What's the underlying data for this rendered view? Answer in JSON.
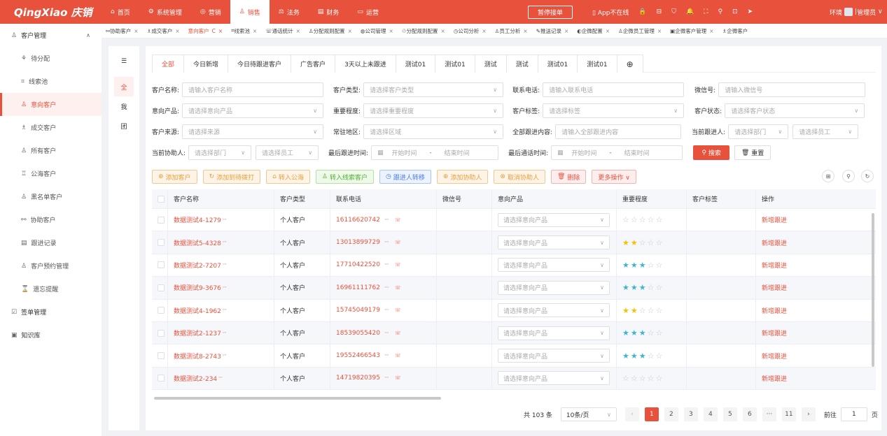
{
  "brand": "QingXiao 庆销",
  "nav": [
    {
      "icon": "⌂",
      "label": "首页"
    },
    {
      "icon": "⚙",
      "label": "系统管理"
    },
    {
      "icon": "◎",
      "label": "营销"
    },
    {
      "icon": "♙",
      "label": "销售"
    },
    {
      "icon": "⚖",
      "label": "法务"
    },
    {
      "icon": "▤",
      "label": "财务"
    },
    {
      "icon": "▭",
      "label": "运营"
    }
  ],
  "pause_button": "暂停接单",
  "app_status": "App不在线",
  "top_icons": [
    "lock-icon",
    "message-icon",
    "shirt-icon",
    "bell-icon",
    "fullscreen-icon",
    "search-icon",
    "inbox-icon",
    "send-icon"
  ],
  "top_glyphs": [
    "🔒",
    "⊟",
    "⛉",
    "🔔",
    "⛶",
    "⚲",
    "⊡",
    "➤"
  ],
  "env_label": "环境",
  "user": "管理员",
  "sidebar": {
    "group1": {
      "icon": "♙",
      "label": "客户管理"
    },
    "items": [
      {
        "icon": "⚘",
        "label": "待分配"
      },
      {
        "icon": "⌗",
        "label": "线索池"
      },
      {
        "icon": "♙",
        "label": "意向客户",
        "active": true
      },
      {
        "icon": "♗",
        "label": "成交客户"
      },
      {
        "icon": "♙",
        "label": "所有客户"
      },
      {
        "icon": "♖",
        "label": "公海客户"
      },
      {
        "icon": "♙",
        "label": "黑名单客户"
      },
      {
        "icon": "⚯",
        "label": "协助客户"
      },
      {
        "icon": "▤",
        "label": "跟进记录"
      },
      {
        "icon": "♙",
        "label": "客户预约管理"
      },
      {
        "icon": "⌛",
        "label": "遗忘提醒"
      }
    ],
    "group2": {
      "icon": "☑",
      "label": "签单管理"
    },
    "group3": {
      "icon": "▣",
      "label": "知识库"
    }
  },
  "tabs": [
    {
      "label": "协助客户"
    },
    {
      "label": "成交客户"
    },
    {
      "label": "意向客户",
      "active": true
    },
    {
      "label": "线索池"
    },
    {
      "label": "通话统计"
    },
    {
      "label": "分配规则配置"
    },
    {
      "label": "公司管理"
    },
    {
      "label": "分配规则配置"
    },
    {
      "label": "公司分析"
    },
    {
      "label": "员工分析"
    },
    {
      "label": "推送记录"
    },
    {
      "label": "企微配置"
    },
    {
      "label": "企微员工管理"
    },
    {
      "label": "企微客户管理"
    },
    {
      "label": "企微客户"
    }
  ],
  "tab_icons": [
    "⚯",
    "♗",
    "",
    "⌗",
    "☏",
    "♙",
    "◍",
    "♲",
    "◷",
    "♙",
    "✎",
    "◐",
    "♙",
    "▣",
    "♗"
  ],
  "mini": [
    "全",
    "我",
    "团"
  ],
  "filter_tabs": [
    "全部",
    "今日新增",
    "今日待跟进客户",
    "广告客户",
    "3天以上未跟进",
    "测试01",
    "测试01",
    "测试",
    "测试",
    "测试01",
    "测试01"
  ],
  "filters": {
    "name_label": "客户名称:",
    "name_ph": "请输入客户名称",
    "type_label": "客户类型:",
    "type_ph": "请选择客户类型",
    "phone_label": "联系电话:",
    "phone_ph": "请输入联系电话",
    "wx_label": "微信号:",
    "wx_ph": "请输入微信号",
    "product_label": "意向产品:",
    "product_ph": "请选择意向产品",
    "importance_label": "重要程度:",
    "importance_ph": "请选择重要程度",
    "tag_label": "客户标签:",
    "tag_ph": "请选择标签",
    "status_label": "客户状态:",
    "status_ph": "请选择客户状态",
    "source_label": "客户来源:",
    "source_ph": "请选择来源",
    "region_label": "常驻地区:",
    "region_ph": "请选择区域",
    "followall_label": "全部跟进内容:",
    "followall_ph": "请输入全部跟进内容",
    "follower_label": "当前跟进人:",
    "dept_ph": "请选择部门",
    "emp_ph": "请选择员工",
    "assist_label": "当前协助人:",
    "lastfollow_label": "最后跟进时间:",
    "start_ph": "开始时间",
    "end_ph": "结束时间",
    "dash": "-",
    "lastcall_label": "最后通话时间:",
    "search_btn": "搜索",
    "reset_btn": "重置"
  },
  "actions": [
    {
      "icon": "⊕",
      "label": "添加客户",
      "style": "orange"
    },
    {
      "icon": "↻",
      "label": "添加到待拨打",
      "style": "orange"
    },
    {
      "icon": "⌂",
      "label": "转入公海",
      "style": "orange"
    },
    {
      "icon": "♙",
      "label": "转入线索客户",
      "style": "green"
    },
    {
      "icon": "◷",
      "label": "跟进人转移",
      "style": "blue"
    },
    {
      "icon": "⊕",
      "label": "添加协助人",
      "style": "orange"
    },
    {
      "icon": "⊗",
      "label": "取消协助人",
      "style": "orange"
    },
    {
      "icon": "🗑",
      "label": "删除",
      "style": "red"
    },
    {
      "icon": "",
      "label": "更多操作 ∨",
      "style": "red"
    }
  ],
  "columns": [
    "客户名称",
    "客户类型",
    "联系电话",
    "微信号",
    "意向产品",
    "重要程度",
    "客户标签",
    "操作"
  ],
  "rows": [
    {
      "name": "数据测试4-1279",
      "type": "个人客户",
      "phone": "16116620742",
      "product_ph": "请选择意向产品",
      "stars": 0,
      "color": "",
      "op": "新增跟进"
    },
    {
      "name": "数据测试5-4328",
      "type": "个人客户",
      "phone": "13013899729",
      "product_ph": "请选择意向产品",
      "stars": 2,
      "color": "y",
      "op": "新增跟进"
    },
    {
      "name": "数据测试2-7207",
      "type": "个人客户",
      "phone": "17710422520",
      "product_ph": "请选择意向产品",
      "stars": 3,
      "color": "b",
      "op": "新增跟进"
    },
    {
      "name": "数据测试9-3676",
      "type": "个人客户",
      "phone": "16961111762",
      "product_ph": "请选择意向产品",
      "stars": 3,
      "color": "b",
      "op": "新增跟进"
    },
    {
      "name": "数据测试4-1962",
      "type": "个人客户",
      "phone": "15745049179",
      "product_ph": "请选择意向产品",
      "stars": 2,
      "color": "y",
      "op": "新增跟进"
    },
    {
      "name": "数据测试2-1237",
      "type": "个人客户",
      "phone": "18539055420",
      "product_ph": "请选择意向产品",
      "stars": 3,
      "color": "b",
      "op": "新增跟进"
    },
    {
      "name": "数据测试8-2743",
      "type": "个人客户",
      "phone": "19552466543",
      "product_ph": "请选择意向产品",
      "stars": 3,
      "color": "b",
      "op": "新增跟进"
    },
    {
      "name": "数据测试2-234",
      "type": "个人客户",
      "phone": "14719820395",
      "product_ph": "请选择意向产品",
      "stars": 0,
      "color": "",
      "op": "新增跟进"
    }
  ],
  "pager": {
    "total": "共 103 条",
    "page_size": "10条/页",
    "pages": [
      "1",
      "2",
      "3",
      "4",
      "5",
      "6",
      "···",
      "11"
    ],
    "current": "1",
    "goto": "前往",
    "goto_value": "1",
    "page_unit": "页"
  },
  "colors": {
    "brand": "#e8513c",
    "star_yellow": "#f2c100",
    "star_blue": "#3fb5c8"
  }
}
